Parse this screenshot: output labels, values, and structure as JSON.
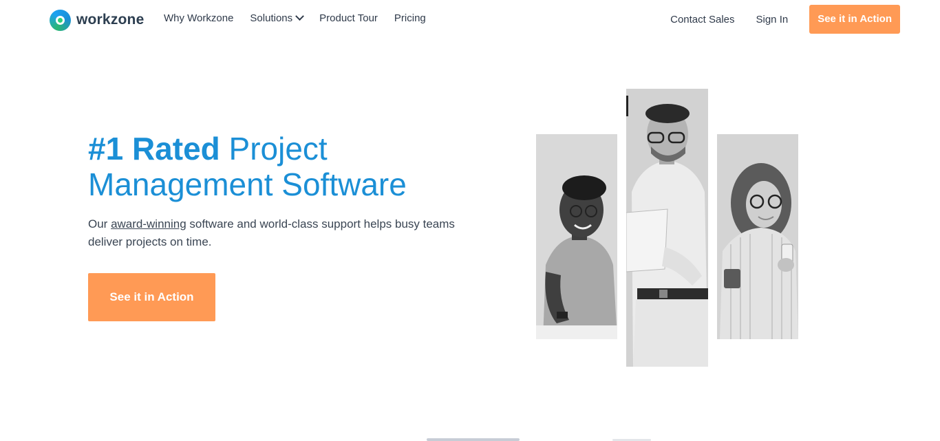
{
  "brand": {
    "name": "workzone",
    "logo_icon": "workzone-ring-icon"
  },
  "nav": {
    "items": [
      {
        "label": "Why Workzone"
      },
      {
        "label": "Solutions",
        "icon": "chevron-down-icon"
      },
      {
        "label": "Product Tour"
      },
      {
        "label": "Pricing"
      }
    ]
  },
  "right_nav": {
    "contact": "Contact Sales",
    "signin": "Sign In",
    "cta": "See it in Action"
  },
  "hero": {
    "title_bold": "#1 Rated",
    "title_rest": " Project Management Software",
    "sub_prefix": "Our ",
    "sub_link": "award-winning",
    "sub_suffix": " software and world-class support helps busy teams deliver projects on time.",
    "cta": "See it in Action"
  },
  "colors": {
    "accent": "#1b8fd6",
    "cta": "#ff9a55",
    "text": "#2f3a4a"
  }
}
